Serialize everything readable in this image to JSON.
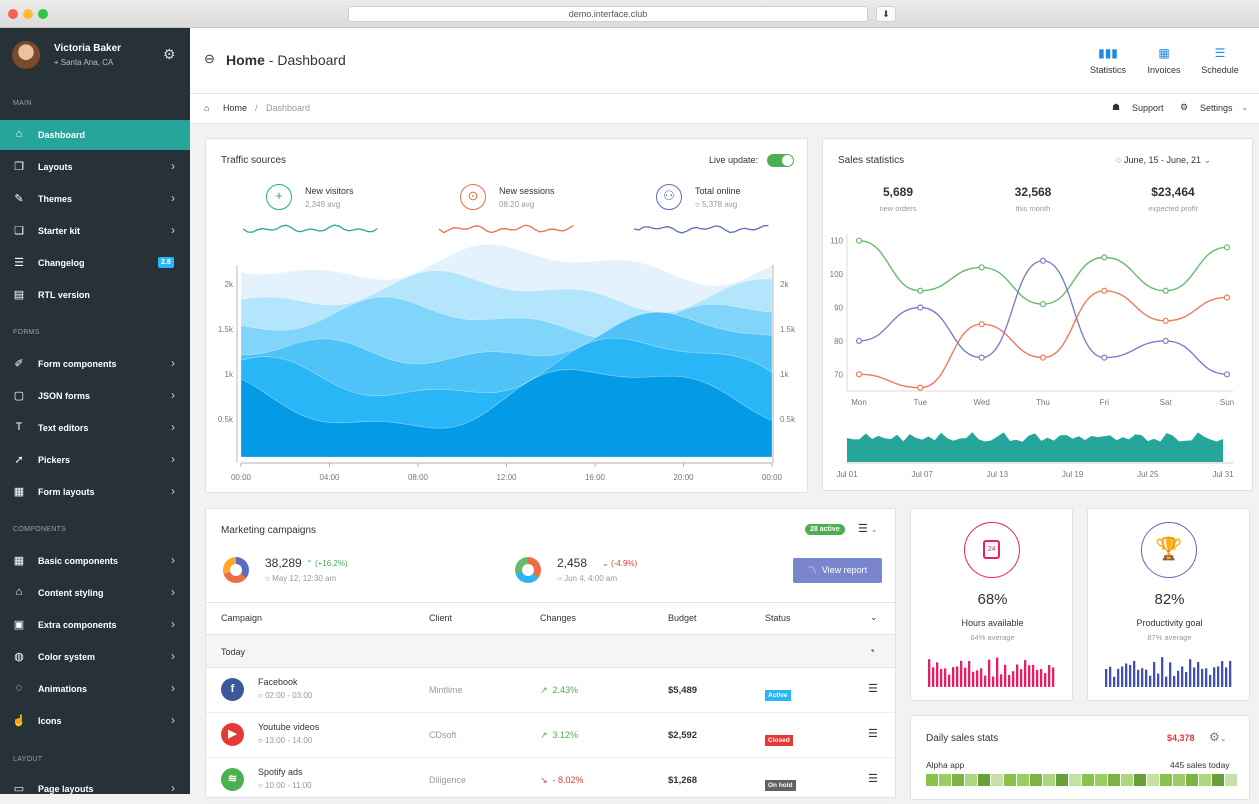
{
  "browser": {
    "url": "demo.interface.club"
  },
  "user": {
    "name": "Victoria Baker",
    "location": "Santa Ana, CA"
  },
  "sidebar": {
    "sections": [
      "MAIN",
      "FORMS",
      "COMPONENTS",
      "LAYOUT"
    ],
    "items": [
      {
        "label": "Dashboard",
        "icon": "home-icon"
      },
      {
        "label": "Layouts",
        "icon": "copy-icon"
      },
      {
        "label": "Themes",
        "icon": "palette-icon"
      },
      {
        "label": "Starter kit",
        "icon": "stack-icon"
      },
      {
        "label": "Changelog",
        "icon": "list-icon",
        "badge": "2.8"
      },
      {
        "label": "RTL version",
        "icon": "rtl-icon"
      },
      {
        "label": "Form components",
        "icon": "pencil-icon"
      },
      {
        "label": "JSON forms",
        "icon": "file-icon"
      },
      {
        "label": "Text editors",
        "icon": "text-icon"
      },
      {
        "label": "Pickers",
        "icon": "pointer-icon"
      },
      {
        "label": "Form layouts",
        "icon": "layout-icon"
      },
      {
        "label": "Basic components",
        "icon": "grid-icon"
      },
      {
        "label": "Content styling",
        "icon": "paint-icon"
      },
      {
        "label": "Extra components",
        "icon": "gift-icon"
      },
      {
        "label": "Color system",
        "icon": "drop-icon"
      },
      {
        "label": "Animations",
        "icon": "spinner-icon"
      },
      {
        "label": "Icons",
        "icon": "thumb-icon"
      },
      {
        "label": "Page layouts",
        "icon": "page-icon"
      }
    ]
  },
  "header": {
    "title_bold": "Home",
    "title_rest": " - Dashboard",
    "buttons": [
      "Statistics",
      "Invoices",
      "Schedule"
    ]
  },
  "breadcrumb": {
    "home": "Home",
    "sep": "/",
    "current": "Dashboard",
    "support": "Support",
    "settings": "Settings"
  },
  "traffic": {
    "title": "Traffic sources",
    "live_label": "Live update:",
    "stats": [
      {
        "label": "New visitors",
        "value": "2,349 avg",
        "color": "#26a69a"
      },
      {
        "label": "New sessions",
        "value": "08:20 avg",
        "color": "#ef6c4a"
      },
      {
        "label": "Total online",
        "value": "5,378 avg",
        "color": "#5c6bc0"
      }
    ],
    "yticks": [
      "2k",
      "1.5k",
      "1k",
      "0.5k"
    ],
    "xticks": [
      "00:00",
      "04:00",
      "08:00",
      "12:00",
      "16:00",
      "20:00",
      "00:00"
    ]
  },
  "sales": {
    "title": "Sales statistics",
    "range": "June, 15 - June, 21",
    "stats": [
      {
        "value": "5,689",
        "label": "new orders"
      },
      {
        "value": "32,568",
        "label": "this month"
      },
      {
        "value": "$23,464",
        "label": "expected profit"
      }
    ],
    "xticks2": [
      "Jul 01",
      "Jul 07",
      "Jul 13",
      "Jul 19",
      "Jul 25",
      "Jul 31"
    ]
  },
  "chart_data": {
    "type": "line",
    "categories": [
      "Mon",
      "Tue",
      "Wed",
      "Thu",
      "Fri",
      "Sat",
      "Sun"
    ],
    "ylim": [
      65,
      112
    ],
    "yticks": [
      110,
      100,
      90,
      80,
      70
    ],
    "series": [
      {
        "values": [
          110,
          95,
          102,
          91,
          105,
          95,
          108
        ],
        "color": "#66bb6a"
      },
      {
        "values": [
          70,
          66,
          85,
          75,
          95,
          86,
          93
        ],
        "color": "#ef7b5a"
      },
      {
        "values": [
          80,
          90,
          75,
          104,
          75,
          80,
          70
        ],
        "color": "#7e7ec9"
      }
    ]
  },
  "marketing": {
    "title": "Marketing campaigns",
    "active": "28 active",
    "kpi": [
      {
        "value": "38,289",
        "change": "(+16.2%)",
        "date": "May 12, 12:30 am",
        "up": true
      },
      {
        "value": "2,458",
        "change": "(-4.9%)",
        "date": "Jun 4, 4:00 am",
        "up": false
      }
    ],
    "view_report": "View report",
    "columns": [
      "Campaign",
      "Client",
      "Changes",
      "Budget",
      "Status"
    ],
    "group": "Today",
    "rows": [
      {
        "name": "Facebook",
        "time": "02:00 - 03:00",
        "client": "Mintlime",
        "change": "2.43%",
        "budget": "$5,489",
        "status": "Active",
        "status_color": "#29b6f6",
        "icon_color": "#3b5998",
        "glyph": "f",
        "dot": "#29b6f6",
        "up": true
      },
      {
        "name": "Youtube videos",
        "time": "13:00 - 14:00",
        "client": "CDsoft",
        "change": "3.12%",
        "budget": "$2,592",
        "status": "Closed",
        "status_color": "#e53935",
        "icon_color": "#e53935",
        "glyph": "▶",
        "dot": "#e53935",
        "up": true
      },
      {
        "name": "Spotify ads",
        "time": "10:00 - 11:00",
        "client": "Diligence",
        "change": "- 8.02%",
        "budget": "$1,268",
        "status": "On hold",
        "status_color": "#616161",
        "icon_color": "#4caf50",
        "glyph": "≋",
        "dot": "#9e9e9e",
        "up": false
      }
    ]
  },
  "hours": {
    "value": "68%",
    "label": "Hours available",
    "sub": "64% average"
  },
  "productivity": {
    "value": "82%",
    "label": "Productivity goal",
    "sub": "87% average"
  },
  "daily": {
    "title": "Daily sales stats",
    "amount": "$4,378",
    "app": "Alpha app",
    "count": "445 sales today"
  }
}
